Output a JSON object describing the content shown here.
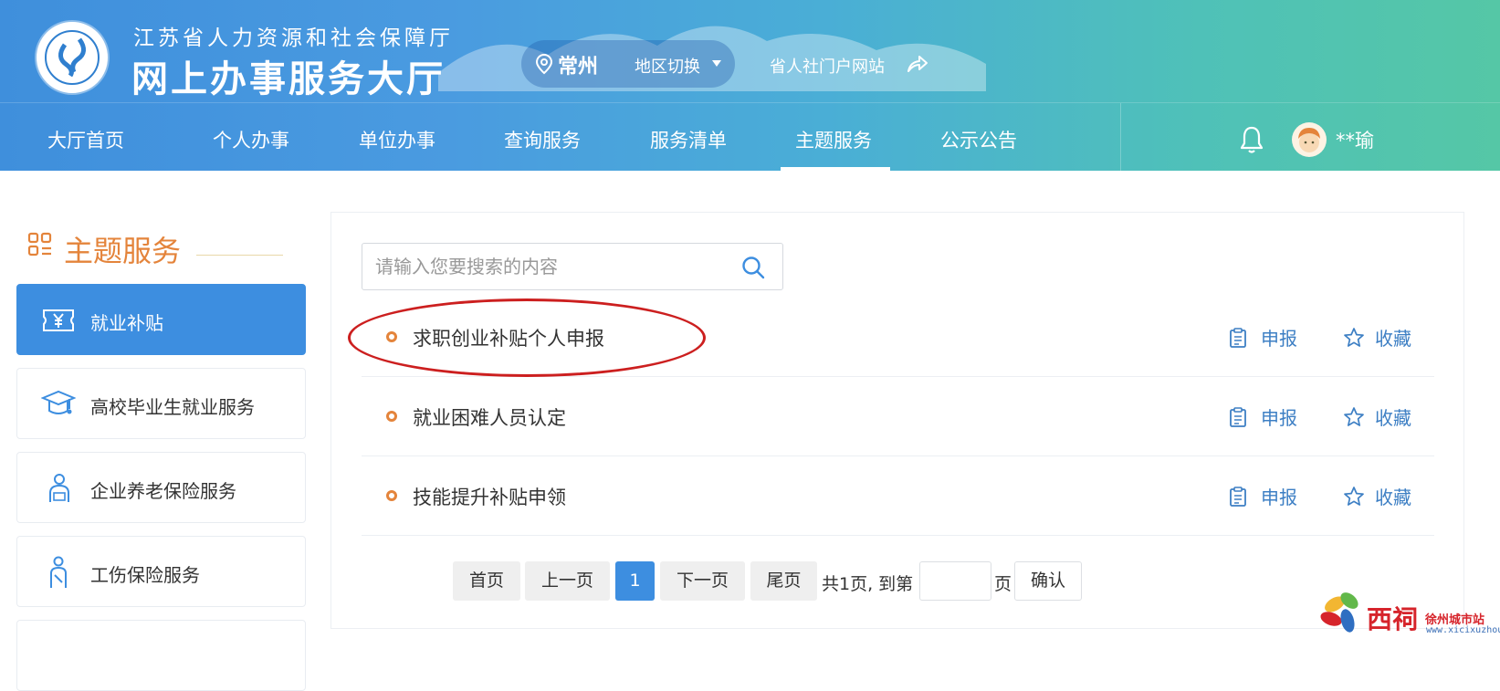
{
  "header": {
    "org_name": "江苏省人力资源和社会保障厅",
    "hall_name": "网上办事服务大厅",
    "city": "常州",
    "region_switch": "地区切换",
    "portal_link": "省人社门户网站",
    "user_name": "**瑜"
  },
  "nav": {
    "items": [
      {
        "label": "大厅首页"
      },
      {
        "label": "个人办事"
      },
      {
        "label": "单位办事"
      },
      {
        "label": "查询服务"
      },
      {
        "label": "服务清单"
      },
      {
        "label": "主题服务",
        "active": true
      },
      {
        "label": "公示公告"
      }
    ]
  },
  "sidebar": {
    "title": "主题服务",
    "items": [
      {
        "label": "就业补贴",
        "icon": "yuan-ticket-icon",
        "active": true
      },
      {
        "label": "高校毕业生就业服务",
        "icon": "graduation-cap-icon"
      },
      {
        "label": "企业养老保险服务",
        "icon": "elderly-worker-icon"
      },
      {
        "label": "工伤保险服务",
        "icon": "injured-worker-icon"
      }
    ]
  },
  "search": {
    "placeholder": "请输入您要搜索的内容",
    "value": ""
  },
  "services": [
    {
      "title": "求职创业补贴个人申报",
      "apply": "申报",
      "favorite": "收藏",
      "highlighted": true
    },
    {
      "title": "就业困难人员认定",
      "apply": "申报",
      "favorite": "收藏"
    },
    {
      "title": "技能提升补贴申领",
      "apply": "申报",
      "favorite": "收藏"
    }
  ],
  "pagination": {
    "first": "首页",
    "prev": "上一页",
    "current": "1",
    "next": "下一页",
    "last": "尾页",
    "total_text": "共1页, 到第",
    "page_suffix": "页",
    "goto_value": "",
    "confirm": "确认"
  },
  "watermark": {
    "brand": "西祠",
    "city": "徐州城市站",
    "url": "www.xicixuzhou.cn"
  },
  "colors": {
    "accent_blue": "#3d8ee0",
    "accent_orange": "#e4843b",
    "link_blue": "#3d7fc4",
    "highlight_red": "#cc1f1f"
  }
}
